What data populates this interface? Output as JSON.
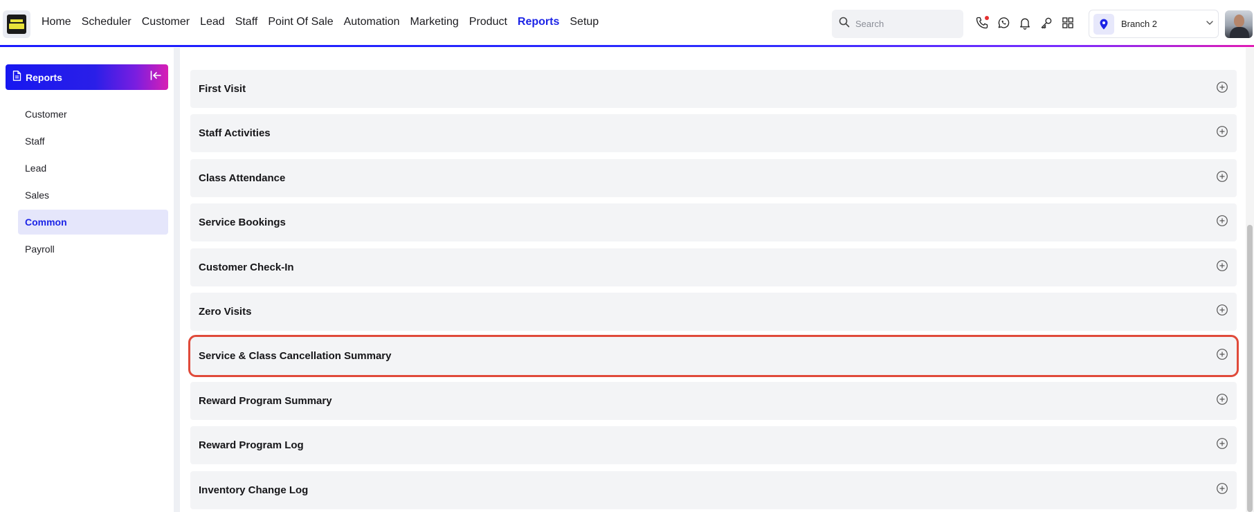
{
  "nav": {
    "items": [
      {
        "label": "Home",
        "active": false
      },
      {
        "label": "Scheduler",
        "active": false
      },
      {
        "label": "Customer",
        "active": false
      },
      {
        "label": "Lead",
        "active": false
      },
      {
        "label": "Staff",
        "active": false
      },
      {
        "label": "Point Of Sale",
        "active": false
      },
      {
        "label": "Automation",
        "active": false
      },
      {
        "label": "Marketing",
        "active": false
      },
      {
        "label": "Product",
        "active": false
      },
      {
        "label": "Reports",
        "active": true
      },
      {
        "label": "Setup",
        "active": false
      }
    ]
  },
  "search": {
    "placeholder": "Search",
    "value": ""
  },
  "top_icons": [
    "phone-icon",
    "whatsapp-icon",
    "bell-icon",
    "key-icon",
    "apps-grid-icon"
  ],
  "branch": {
    "label": "Branch 2"
  },
  "sidebar": {
    "header": "Reports",
    "items": [
      {
        "label": "Customer",
        "active": false
      },
      {
        "label": "Staff",
        "active": false
      },
      {
        "label": "Lead",
        "active": false
      },
      {
        "label": "Sales",
        "active": false
      },
      {
        "label": "Common",
        "active": true
      },
      {
        "label": "Payroll",
        "active": false
      }
    ]
  },
  "reports": [
    {
      "label": "First Visit",
      "highlighted": false
    },
    {
      "label": "Staff Activities",
      "highlighted": false
    },
    {
      "label": "Class Attendance",
      "highlighted": false
    },
    {
      "label": "Service Bookings",
      "highlighted": false
    },
    {
      "label": "Customer Check-In",
      "highlighted": false
    },
    {
      "label": "Zero Visits",
      "highlighted": false
    },
    {
      "label": "Service & Class Cancellation Summary",
      "highlighted": true
    },
    {
      "label": "Reward Program Summary",
      "highlighted": false
    },
    {
      "label": "Reward Program Log",
      "highlighted": false
    },
    {
      "label": "Inventory Change Log",
      "highlighted": false
    }
  ],
  "colors": {
    "accent": "#1c24e6",
    "highlight_border": "#e04a3a",
    "gradient_start": "#1717f0",
    "gradient_end": "#d81fb4",
    "notification_dot": "#e53030"
  }
}
